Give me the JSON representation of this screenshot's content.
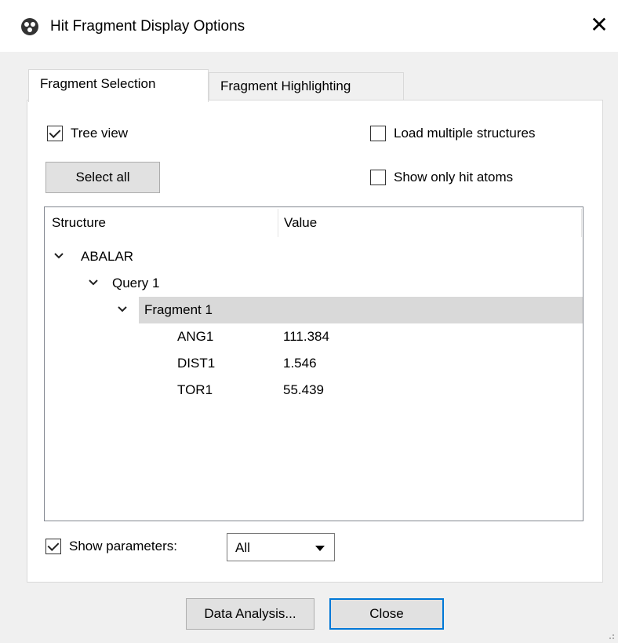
{
  "window": {
    "title": "Hit Fragment Display Options",
    "close_glyph": "✕"
  },
  "tabs": [
    {
      "label": "Fragment Selection",
      "active": true
    },
    {
      "label": "Fragment Highlighting",
      "active": false
    }
  ],
  "options": {
    "tree_view": {
      "label": "Tree view",
      "checked": true
    },
    "load_multiple": {
      "label": "Load multiple structures",
      "checked": false
    },
    "show_only_hit_atoms": {
      "label": "Show only hit atoms",
      "checked": false
    },
    "select_all_label": "Select all"
  },
  "tree": {
    "columns": [
      "Structure",
      "Value"
    ],
    "rows": [
      {
        "label": "ABALAR",
        "value": "",
        "expanded": true,
        "level": 0
      },
      {
        "label": "Query 1",
        "value": "",
        "expanded": true,
        "level": 1
      },
      {
        "label": "Fragment 1",
        "value": "",
        "expanded": true,
        "level": 2,
        "selected": true
      },
      {
        "label": "ANG1",
        "value": "111.384",
        "level": 3
      },
      {
        "label": "DIST1",
        "value": "1.546",
        "level": 3
      },
      {
        "label": "TOR1",
        "value": "55.439",
        "level": 3
      }
    ]
  },
  "parameters": {
    "label": "Show parameters:",
    "checked": true,
    "selected": "All"
  },
  "footer": {
    "data_analysis_label": "Data Analysis...",
    "close_label": "Close"
  },
  "icons": {
    "app": "molecule-icon",
    "expand": "chevron-down-icon"
  }
}
